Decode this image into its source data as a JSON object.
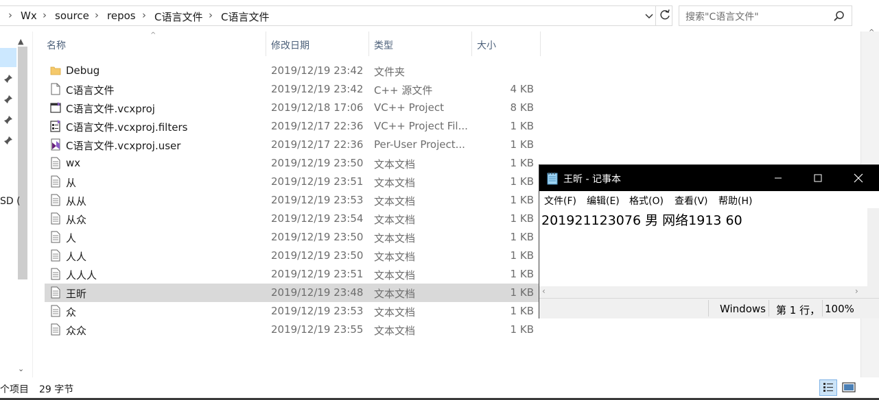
{
  "address": {
    "crumbs": [
      "Wx",
      "source",
      "repos",
      "C语言文件",
      "C语言文件"
    ],
    "separator": "›"
  },
  "search": {
    "placeholder": "搜索\"C语言文件\""
  },
  "left": {
    "partial_label": "SD ("
  },
  "columns": {
    "name": "名称",
    "date": "修改日期",
    "type": "类型",
    "size": "大小"
  },
  "files": [
    {
      "name": "Debug",
      "date": "2019/12/19 23:42",
      "type": "文件夹",
      "size": "",
      "icon": "folder-icon"
    },
    {
      "name": "C语言文件",
      "date": "2019/12/19 23:42",
      "type": "C++ 源文件",
      "size": "4 KB",
      "icon": "file-icon"
    },
    {
      "name": "C语言文件.vcxproj",
      "date": "2019/12/18 17:06",
      "type": "VC++ Project",
      "size": "8 KB",
      "icon": "vcxproj-icon"
    },
    {
      "name": "C语言文件.vcxproj.filters",
      "date": "2019/12/17 22:36",
      "type": "VC++ Project Fil...",
      "size": "1 KB",
      "icon": "filters-icon"
    },
    {
      "name": "C语言文件.vcxproj.user",
      "date": "2019/12/17 22:36",
      "type": "Per-User Project...",
      "size": "1 KB",
      "icon": "vs-user-icon"
    },
    {
      "name": "wx",
      "date": "2019/12/19 23:50",
      "type": "文本文档",
      "size": "1 KB",
      "icon": "text-file-icon"
    },
    {
      "name": "从",
      "date": "2019/12/19 23:51",
      "type": "文本文档",
      "size": "1 KB",
      "icon": "text-file-icon"
    },
    {
      "name": "从从",
      "date": "2019/12/19 23:53",
      "type": "文本文档",
      "size": "1 KB",
      "icon": "text-file-icon"
    },
    {
      "name": "从众",
      "date": "2019/12/19 23:54",
      "type": "文本文档",
      "size": "1 KB",
      "icon": "text-file-icon"
    },
    {
      "name": "人",
      "date": "2019/12/19 23:50",
      "type": "文本文档",
      "size": "1 KB",
      "icon": "text-file-icon"
    },
    {
      "name": "人人",
      "date": "2019/12/19 23:50",
      "type": "文本文档",
      "size": "1 KB",
      "icon": "text-file-icon"
    },
    {
      "name": "人人人",
      "date": "2019/12/19 23:51",
      "type": "文本文档",
      "size": "1 KB",
      "icon": "text-file-icon"
    },
    {
      "name": "王昕",
      "date": "2019/12/19 23:48",
      "type": "文本文档",
      "size": "1 KB",
      "icon": "text-file-icon",
      "selected": true
    },
    {
      "name": "众",
      "date": "2019/12/19 23:53",
      "type": "文本文档",
      "size": "1 KB",
      "icon": "text-file-icon"
    },
    {
      "name": "众众",
      "date": "2019/12/19 23:55",
      "type": "文本文档",
      "size": "1 KB",
      "icon": "text-file-icon"
    }
  ],
  "status": {
    "items": "个项目",
    "size": "29 字节"
  },
  "notepad": {
    "title": "王昕 - 记事本",
    "menu": [
      "文件(F)",
      "编辑(E)",
      "格式(O)",
      "查看(V)",
      "帮助(H)"
    ],
    "content": "201921123076 男 网络1913 60",
    "status": {
      "encoding": "Windows",
      "position": "第 1 行，",
      "zoom": "100%"
    }
  },
  "colors": {
    "selected_row": "#d9d9d9",
    "header_text": "#4c607a",
    "notepad_title": "#000000"
  }
}
